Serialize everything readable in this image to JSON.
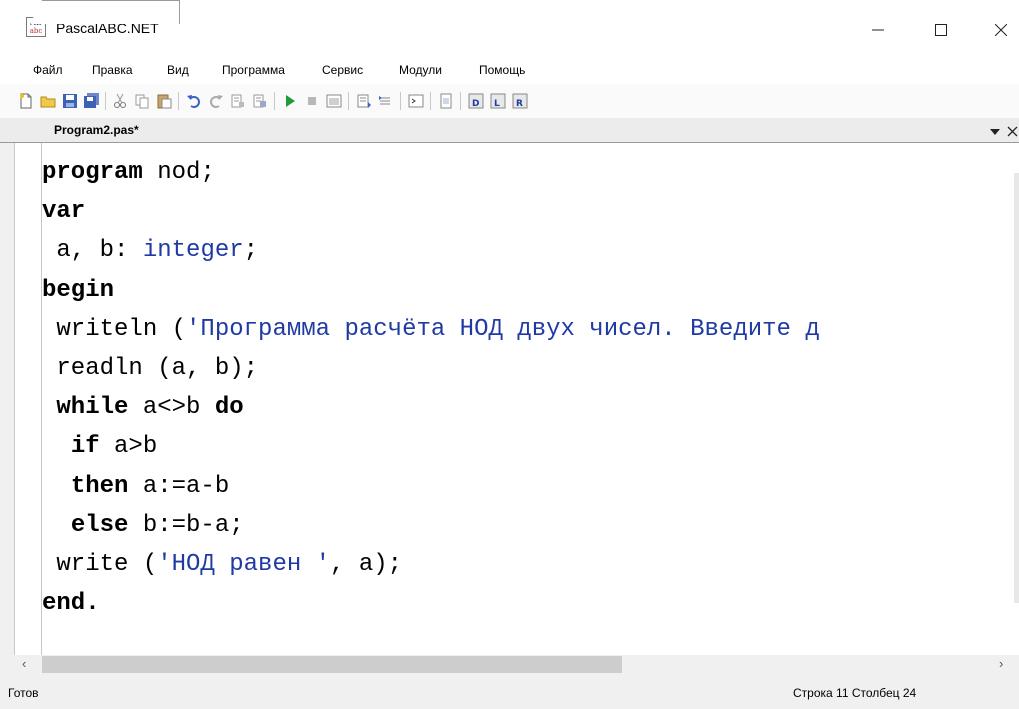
{
  "window": {
    "title": "PascalABC.NET",
    "icon": "pascalabc-app-icon",
    "icon_text_top": "AB",
    "icon_text_bottom": "abc",
    "controls": {
      "minimize": "minimize-icon",
      "maximize": "maximize-icon",
      "close": "close-icon"
    }
  },
  "menu": {
    "items": [
      "Файл",
      "Правка",
      "Вид",
      "Программа",
      "Сервис",
      "Модули",
      "Помощь"
    ]
  },
  "toolbar": {
    "buttons": [
      "new-file-icon",
      "open-folder-icon",
      "save-icon",
      "save-all-icon",
      "cut-icon",
      "copy-icon",
      "paste-icon",
      "undo-icon",
      "redo-icon",
      "find-icon",
      "replace-icon",
      "run-icon",
      "stop-icon",
      "debug-window-icon",
      "step-into-icon",
      "step-over-icon",
      "console-icon",
      "output-icon",
      "view-d-icon",
      "view-l-icon",
      "view-r-icon"
    ]
  },
  "tab": {
    "label": "Program2.pas*",
    "dropdown_icon": "chevron-down-icon",
    "close_icon": "close-icon"
  },
  "editor": {
    "lines": [
      [
        {
          "t": "program",
          "k": "kw"
        },
        {
          "t": " nod;"
        }
      ],
      [
        {
          "t": "var",
          "k": "kw"
        }
      ],
      [
        {
          "t": " a, b: "
        },
        {
          "t": "integer",
          "k": "tp"
        },
        {
          "t": ";"
        }
      ],
      [
        {
          "t": "begin",
          "k": "kw"
        }
      ],
      [
        {
          "t": " writeln ("
        },
        {
          "t": "'Программа расчёта НОД двух чисел. Введите д",
          "k": "str"
        }
      ],
      [
        {
          "t": " readln (a, b);"
        }
      ],
      [
        {
          "t": " "
        },
        {
          "t": "while",
          "k": "kw"
        },
        {
          "t": " a<>b "
        },
        {
          "t": "do",
          "k": "kw"
        }
      ],
      [
        {
          "t": "  "
        },
        {
          "t": "if",
          "k": "kw"
        },
        {
          "t": " a>b"
        }
      ],
      [
        {
          "t": "  "
        },
        {
          "t": "then",
          "k": "kw"
        },
        {
          "t": " a:=a-b"
        }
      ],
      [
        {
          "t": "  "
        },
        {
          "t": "else",
          "k": "kw"
        },
        {
          "t": " b:=b-a;"
        }
      ],
      [
        {
          "t": " write ("
        },
        {
          "t": "'НОД равен '",
          "k": "str"
        },
        {
          "t": ", a);"
        }
      ],
      [
        {
          "t": "end.",
          "k": "kw"
        }
      ]
    ]
  },
  "status": {
    "left": "Готов",
    "position": "Строка 11 Столбец 24"
  },
  "colors": {
    "keyword": "#000000",
    "type": "#1f3aa3",
    "string": "#1f3aa3"
  }
}
